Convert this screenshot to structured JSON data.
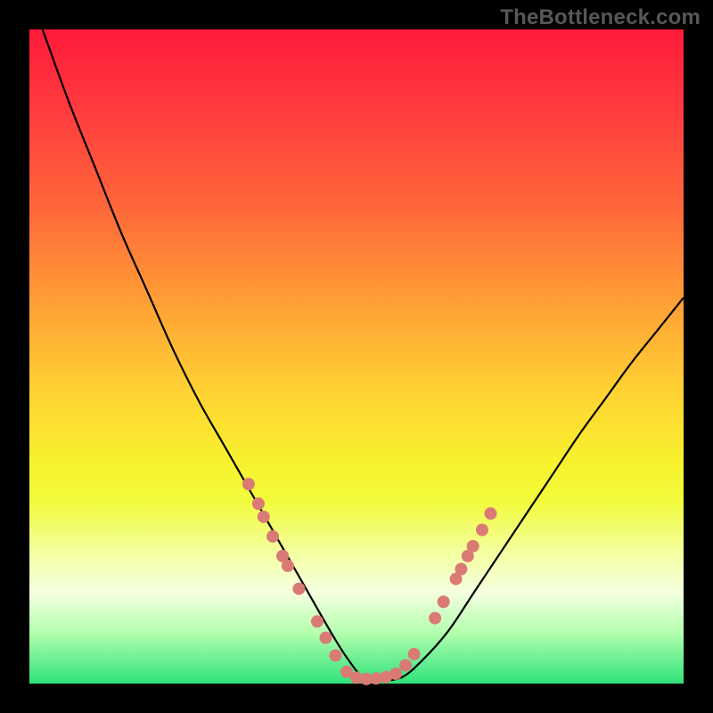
{
  "watermark": "TheBottleneck.com",
  "chart_data": {
    "type": "line",
    "title": "",
    "xlabel": "",
    "ylabel": "",
    "xlim": [
      0,
      100
    ],
    "ylim": [
      0,
      100
    ],
    "grid": false,
    "series": [
      {
        "name": "curve",
        "x": [
          2,
          6,
          10,
          14,
          18,
          22,
          26,
          30,
          34,
          38,
          42,
          46,
          48.5,
          51,
          54,
          57,
          60,
          64,
          68,
          72,
          76,
          80,
          84,
          88,
          92,
          96,
          100
        ],
        "y": [
          100,
          89,
          79,
          69,
          60,
          51,
          43,
          36,
          29,
          22,
          15,
          8,
          4,
          1,
          0.5,
          1,
          3.5,
          8,
          14,
          20,
          26,
          32,
          38,
          43.5,
          49,
          54,
          59
        ]
      }
    ],
    "markers": [
      {
        "x": 33.5,
        "y": 30.5
      },
      {
        "x": 35.0,
        "y": 27.5
      },
      {
        "x": 35.8,
        "y": 25.5
      },
      {
        "x": 37.2,
        "y": 22.5
      },
      {
        "x": 38.7,
        "y": 19.5
      },
      {
        "x": 39.5,
        "y": 18.0
      },
      {
        "x": 41.2,
        "y": 14.5
      },
      {
        "x": 44.0,
        "y": 9.5
      },
      {
        "x": 45.3,
        "y": 7.0
      },
      {
        "x": 46.8,
        "y": 4.3
      },
      {
        "x": 48.5,
        "y": 1.8
      },
      {
        "x": 50.0,
        "y": 0.9
      },
      {
        "x": 51.5,
        "y": 0.7
      },
      {
        "x": 53.0,
        "y": 0.8
      },
      {
        "x": 54.5,
        "y": 1.0
      },
      {
        "x": 56.0,
        "y": 1.5
      },
      {
        "x": 57.5,
        "y": 2.8
      },
      {
        "x": 58.8,
        "y": 4.5
      },
      {
        "x": 62.0,
        "y": 10.0
      },
      {
        "x": 63.3,
        "y": 12.5
      },
      {
        "x": 65.2,
        "y": 16.0
      },
      {
        "x": 66.0,
        "y": 17.5
      },
      {
        "x": 67.0,
        "y": 19.5
      },
      {
        "x": 67.8,
        "y": 21.0
      },
      {
        "x": 69.2,
        "y": 23.5
      },
      {
        "x": 70.5,
        "y": 26.0
      }
    ],
    "marker_radius_px": 7
  }
}
